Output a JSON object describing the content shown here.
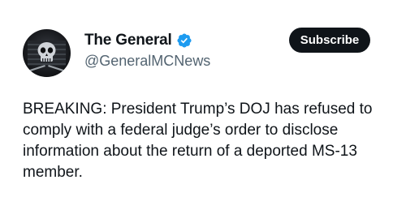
{
  "author": {
    "display_name": "The General",
    "handle": "@GeneralMCNews",
    "verified": true,
    "avatar_icon": "skull-flag-avatar"
  },
  "actions": {
    "subscribe_label": "Subscribe"
  },
  "tweet": {
    "text": "BREAKING: President Trump’s DOJ has refused to comply with a federal judge’s order to disclose information about the return of a deported MS-13 member."
  },
  "colors": {
    "text": "#0f1419",
    "muted": "#536471",
    "verified_badge": "#1d9bf0",
    "button_bg": "#0f1419"
  }
}
